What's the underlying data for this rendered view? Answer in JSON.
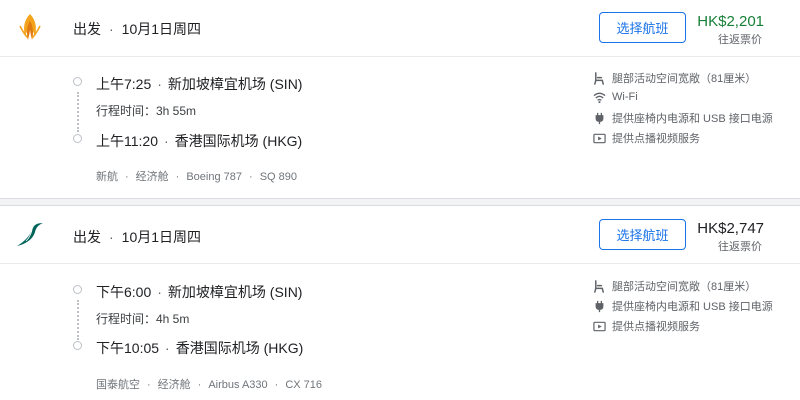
{
  "flights": [
    {
      "airline_logo": "singapore-airlines-logo",
      "header": {
        "direction": "出发",
        "date": "10月1日周四"
      },
      "select_label": "选择航班",
      "price": "HK$2,201",
      "price_type": "往返票价",
      "price_color": "#188038",
      "departure": {
        "time": "上午7:25",
        "airport": "新加坡樟宜机场 (SIN)"
      },
      "duration": "行程时间：3h 55m",
      "arrival": {
        "time": "上午11:20",
        "airport": "香港国际机场 (HKG)"
      },
      "meta": [
        "新航",
        "经济舱",
        "Boeing 787",
        "SQ 890"
      ],
      "amenities": [
        {
          "icon": "seat-icon",
          "label": "腿部活动空间宽敞（81厘米）"
        },
        {
          "icon": "wifi-icon",
          "label": "Wi-Fi"
        },
        {
          "icon": "power-plug-icon",
          "label": "提供座椅内电源和 USB 接口电源"
        },
        {
          "icon": "video-icon",
          "label": "提供点播视频服务"
        }
      ]
    },
    {
      "airline_logo": "cathay-pacific-logo",
      "header": {
        "direction": "出发",
        "date": "10月1日周四"
      },
      "select_label": "选择航班",
      "price": "HK$2,747",
      "price_type": "往返票价",
      "price_color": "#202124",
      "departure": {
        "time": "下午6:00",
        "airport": "新加坡樟宜机场 (SIN)"
      },
      "duration": "行程时间：4h 5m",
      "arrival": {
        "time": "下午10:05",
        "airport": "香港国际机场 (HKG)"
      },
      "meta": [
        "国泰航空",
        "经济舱",
        "Airbus A330",
        "CX 716"
      ],
      "amenities": [
        {
          "icon": "seat-icon",
          "label": "腿部活动空间宽敞（81厘米）"
        },
        {
          "icon": "power-plug-icon",
          "label": "提供座椅内电源和 USB 接口电源"
        },
        {
          "icon": "video-icon",
          "label": "提供点播视频服务"
        }
      ]
    }
  ]
}
